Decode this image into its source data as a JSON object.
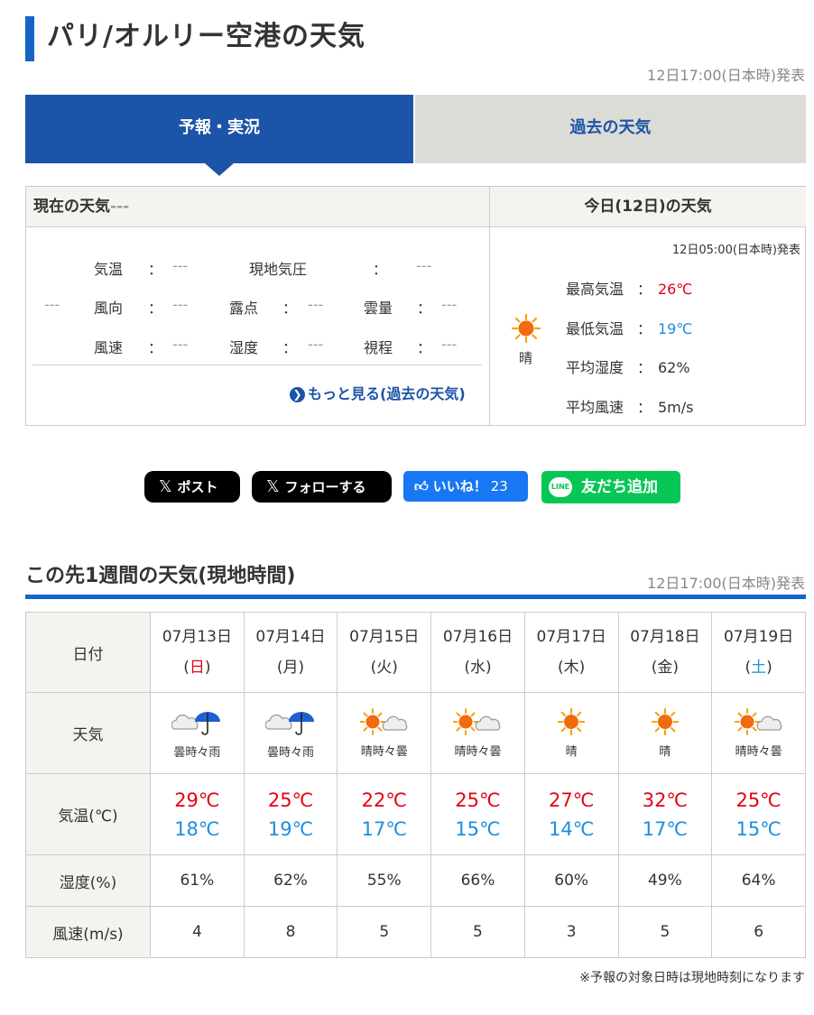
{
  "page": {
    "title": "パリ/オルリー空港の天気",
    "issued": "12日17:00(日本時)発表"
  },
  "tabs": {
    "forecast": "予報・実況",
    "past": "過去の天気"
  },
  "current": {
    "heading": "現在の天気",
    "heading_value": "---",
    "temp_label": "気温",
    "temp_value": "---",
    "pressure_label": "現地気圧",
    "pressure_value": "---",
    "weather_value": "---",
    "wind_dir_label": "風向",
    "wind_dir_value": "---",
    "dew_label": "露点",
    "dew_value": "---",
    "cloud_label": "雲量",
    "cloud_value": "---",
    "wind_speed_label": "風速",
    "wind_speed_value": "---",
    "humidity_label": "湿度",
    "humidity_value": "---",
    "visibility_label": "視程",
    "visibility_value": "---",
    "colon": "：",
    "more_link": "もっと見る(過去の天気)"
  },
  "today": {
    "heading": "今日(12日)の天気",
    "issued": "12日05:00(日本時)発表",
    "weather": "晴",
    "weather_icon": "sun-icon",
    "max_label": "最高気温",
    "max_value": "26℃",
    "min_label": "最低気温",
    "min_value": "19℃",
    "humidity_label": "平均湿度",
    "humidity_value": "62%",
    "wind_label": "平均風速",
    "wind_value": "5m/s",
    "colon": "："
  },
  "share": {
    "post": "ポスト",
    "follow": "フォローする",
    "like": "いいね！",
    "like_count": "23",
    "line_add": "友だち追加",
    "line_logo": "LINE"
  },
  "week": {
    "title": "この先1週間の天気(現地時間)",
    "issued": "12日17:00(日本時)発表",
    "row_labels": {
      "date": "日付",
      "weather": "天気",
      "temp": "気温(℃)",
      "humidity": "湿度(%)",
      "wind": "風速(m/s)"
    },
    "days": [
      {
        "date": "07月13日",
        "dow": "日",
        "weather": "曇時々雨",
        "icon": "cloud-umbrella-icon",
        "high": "29℃",
        "low": "18℃",
        "humidity": "61%",
        "wind": "4"
      },
      {
        "date": "07月14日",
        "dow": "月",
        "weather": "曇時々雨",
        "icon": "cloud-umbrella-icon",
        "high": "25℃",
        "low": "19℃",
        "humidity": "62%",
        "wind": "8"
      },
      {
        "date": "07月15日",
        "dow": "火",
        "weather": "晴時々曇",
        "icon": "sun-cloud-icon",
        "high": "22℃",
        "low": "17℃",
        "humidity": "55%",
        "wind": "5"
      },
      {
        "date": "07月16日",
        "dow": "水",
        "weather": "晴時々曇",
        "icon": "sun-cloud-icon",
        "high": "25℃",
        "low": "15℃",
        "humidity": "66%",
        "wind": "5"
      },
      {
        "date": "07月17日",
        "dow": "木",
        "weather": "晴",
        "icon": "sun-icon",
        "high": "27℃",
        "low": "14℃",
        "humidity": "60%",
        "wind": "3"
      },
      {
        "date": "07月18日",
        "dow": "金",
        "weather": "晴",
        "icon": "sun-icon",
        "high": "32℃",
        "low": "17℃",
        "humidity": "49%",
        "wind": "5"
      },
      {
        "date": "07月19日",
        "dow": "土",
        "weather": "晴時々曇",
        "icon": "sun-cloud-icon",
        "high": "25℃",
        "low": "15℃",
        "humidity": "64%",
        "wind": "6"
      }
    ],
    "footnote": "※予報の対象日時は現地時刻になります"
  },
  "colors": {
    "accent": "#1b54a8",
    "hot": "#e60012",
    "cold": "#1a8fe0",
    "sunday": "#e60012",
    "saturday": "#1a8fe0"
  }
}
